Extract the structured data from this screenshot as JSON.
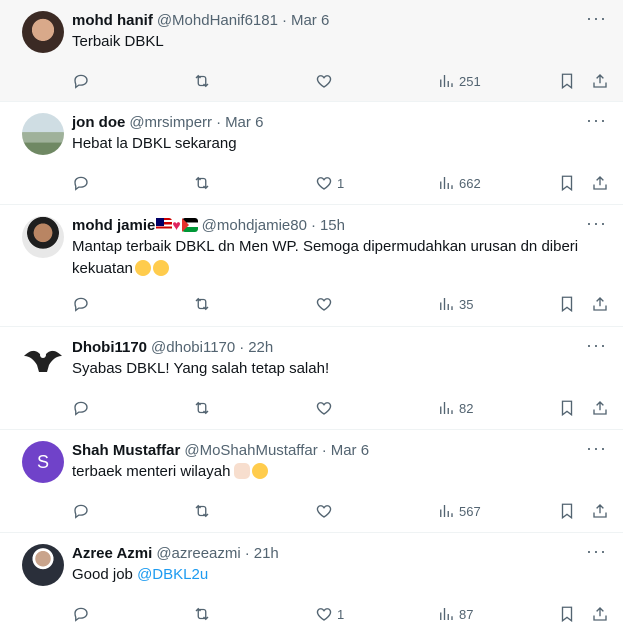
{
  "tweets": [
    {
      "name": "mohd hanif",
      "handle": "@MohdHanif6181",
      "time": "Mar 6",
      "text": "Terbaik DBKL",
      "likes": "",
      "views": "251"
    },
    {
      "name": "jon doe",
      "handle": "@mrsimperr",
      "time": "Mar 6",
      "text": "Hebat la DBKL sekarang",
      "likes": "1",
      "views": "662"
    },
    {
      "name": "mohd jamie",
      "handle": "@mohdjamie80",
      "time": "15h",
      "text": "Mantap terbaik DBKL dn Men WP. Semoga dipermudahkan urusan dn diberi kekuatan",
      "likes": "",
      "views": "35"
    },
    {
      "name": "Dhobi1170",
      "handle": "@dhobi1170",
      "time": "22h",
      "text": "Syabas DBKL! Yang salah tetap salah!",
      "likes": "",
      "views": "82"
    },
    {
      "name": "Shah Mustaffar",
      "handle": "@MoShahMustaffar",
      "time": "Mar 6",
      "text": "terbaek menteri wilayah",
      "avatar_letter": "S",
      "likes": "",
      "views": "567"
    },
    {
      "name": "Azree Azmi",
      "handle": "@azreeazmi",
      "time": "21h",
      "text": "Good job",
      "mention": "@DBKL2u",
      "likes": "1",
      "views": "87"
    }
  ],
  "dot": "·",
  "more_label": "···",
  "icons": [
    "reply-icon",
    "retweet-icon",
    "like-icon",
    "views-icon",
    "bookmark-icon",
    "share-icon"
  ],
  "colors": {
    "link": "#1d9bf0",
    "muted": "#536471",
    "avatar_shah": "#7042c9"
  }
}
